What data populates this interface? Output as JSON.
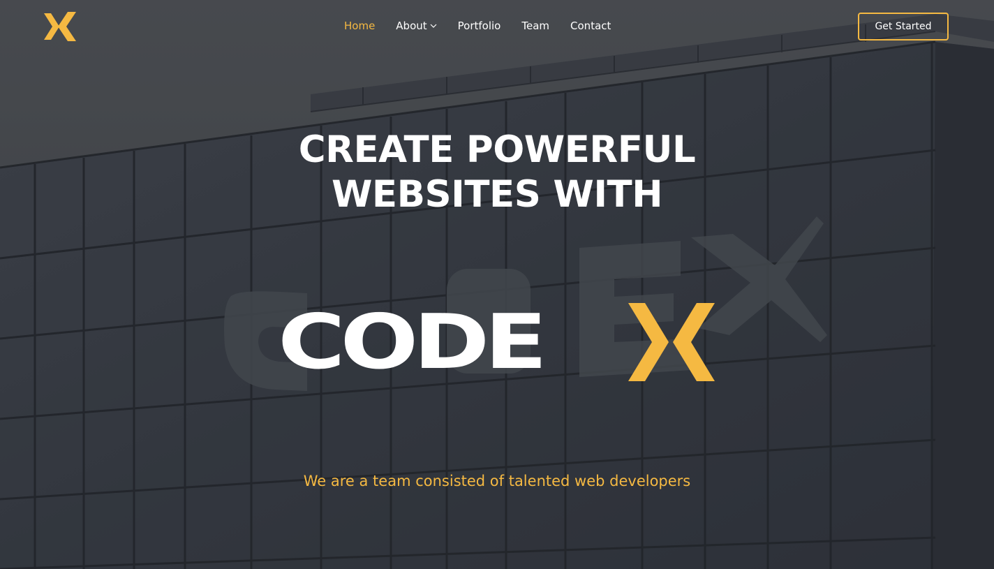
{
  "header": {
    "logo_icon": "codex-x-logo-icon",
    "nav": [
      {
        "label": "Home",
        "active": true
      },
      {
        "label": "About",
        "has_dropdown": true
      },
      {
        "label": "Portfolio"
      },
      {
        "label": "Team"
      },
      {
        "label": "Contact"
      }
    ],
    "cta_label": "Get Started"
  },
  "hero": {
    "headline_line1": "CREATE POWERFUL",
    "headline_line2": "WEBSITES WITH",
    "brand_text": "CODE",
    "tagline": "We are a team consisted of talented web developers"
  },
  "colors": {
    "accent": "#f5b942",
    "text": "#ffffff",
    "overlay": "#3a3d43"
  }
}
